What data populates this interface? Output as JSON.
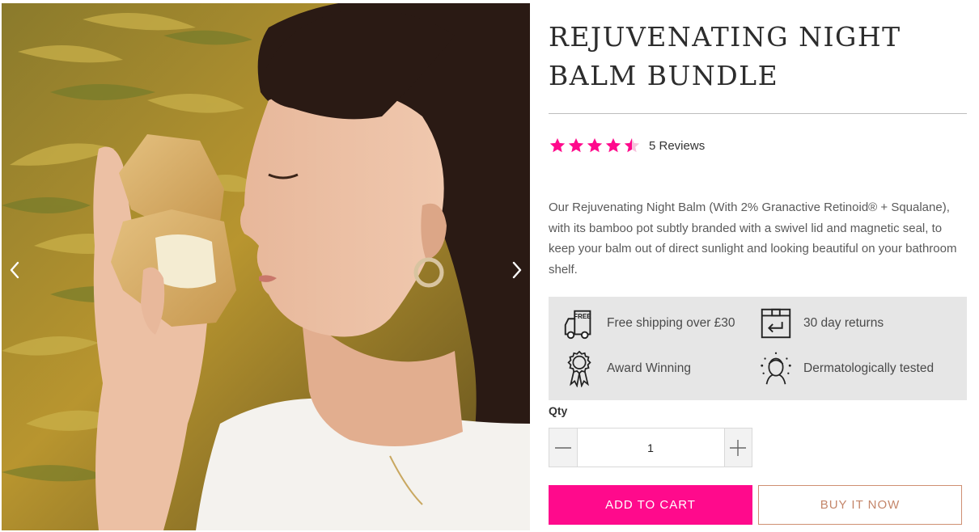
{
  "product": {
    "title": "REJUVENATING NIGHT BALM BUNDLE",
    "rating": 4.5,
    "reviews_label": "5 Reviews",
    "description": "Our Rejuvenating Night Balm (With 2% Granactive Retinoid® + Squalane), with its bamboo pot subtly branded with a swivel lid and magnetic seal, to keep your balm out of direct sunlight and looking beautiful on your bathroom shelf."
  },
  "gallery": {
    "prev_icon": "chevron-left-icon",
    "next_icon": "chevron-right-icon"
  },
  "features": [
    {
      "icon": "free-delivery-truck-icon",
      "label": "Free shipping over £30"
    },
    {
      "icon": "returns-box-icon",
      "label": "30 day returns"
    },
    {
      "icon": "award-rosette-icon",
      "label": "Award Winning"
    },
    {
      "icon": "face-tested-icon",
      "label": "Dermatologically tested"
    }
  ],
  "truck_text": "FREE",
  "quantity": {
    "label": "Qty",
    "value": "1"
  },
  "buttons": {
    "add_to_cart": "ADD TO CART",
    "buy_now": "BUY IT NOW"
  },
  "colors": {
    "accent": "#ff0a8c",
    "buy_now_text": "#c4866a",
    "feature_bg": "#e6e6e6"
  }
}
